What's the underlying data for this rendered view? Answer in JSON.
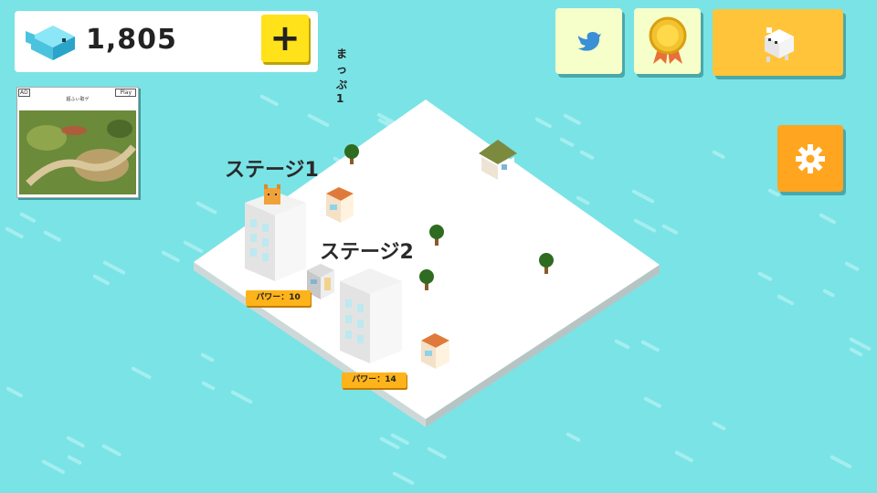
{
  "currency": {
    "icon": "fish-icon",
    "amount": "1,805",
    "add_label": "+",
    "map_name": "まっぷ1"
  },
  "ad": {
    "badge": "AD",
    "play_label": "Play",
    "title": "超ふぃ取ゲ"
  },
  "buttons": {
    "twitter_icon": "twitter-bird-icon",
    "medal_icon": "medal-icon",
    "character_icon": "white-dog-icon",
    "settings_icon": "gear-icon"
  },
  "stages": [
    {
      "label": "ステージ1",
      "power": "パワー：10"
    },
    {
      "label": "ステージ2",
      "power": "パワー：14"
    }
  ],
  "colors": {
    "water": "#7ae3e6",
    "board": "#ffffff",
    "plus_button": "#ffe21a",
    "settings_button": "#ffa51f",
    "character_button": "#ffc43a",
    "power_badge": "#ffb31a"
  }
}
